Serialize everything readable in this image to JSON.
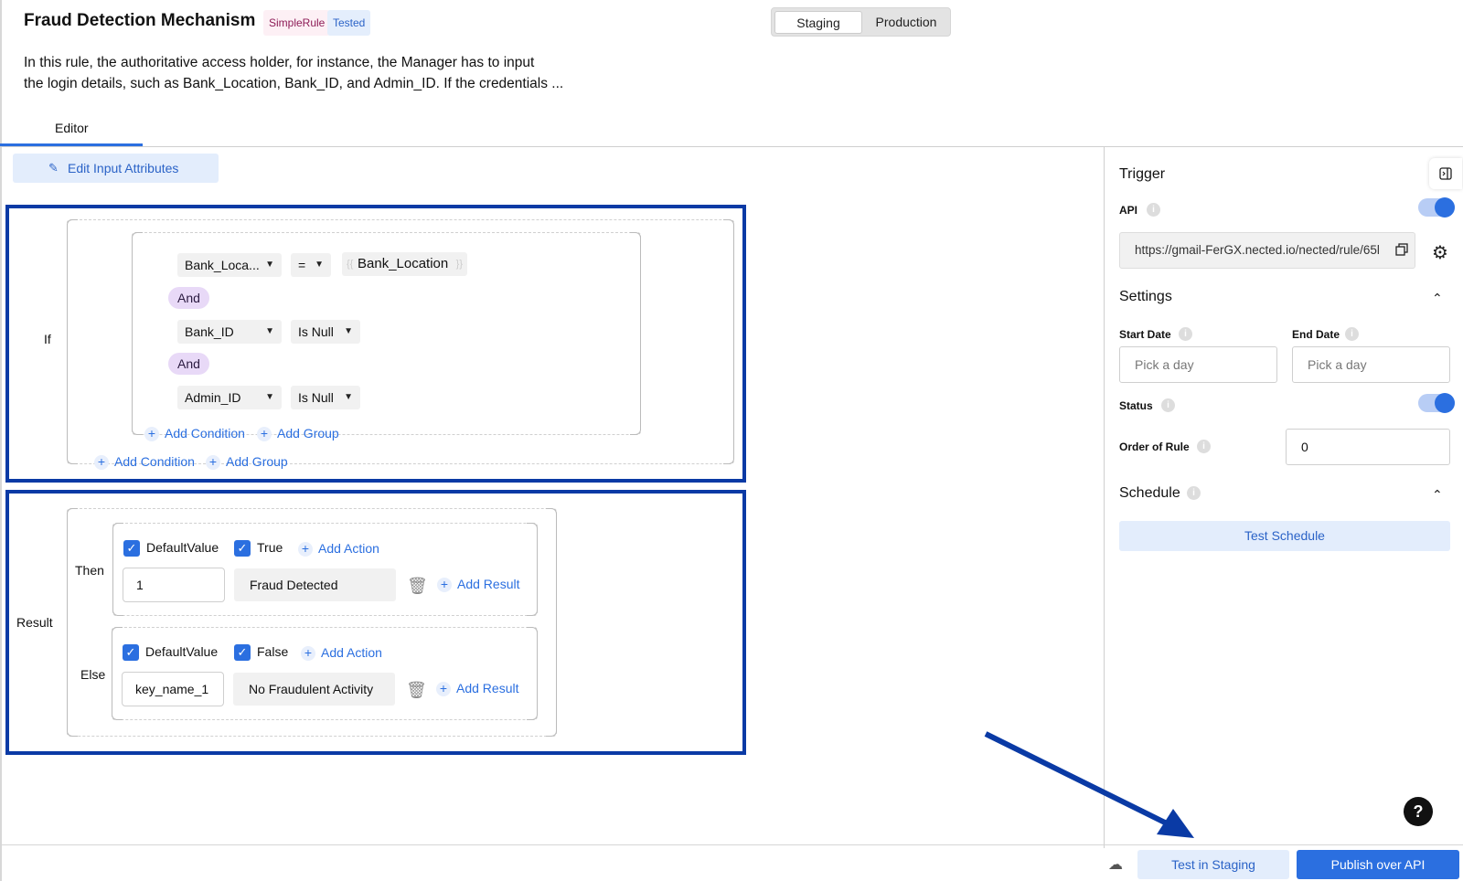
{
  "header": {
    "title": "Fraud Detection Mechanism",
    "badges": [
      "SimpleRule",
      "Tested"
    ],
    "environments": [
      "Staging",
      "Production"
    ],
    "selected_environment": "Staging",
    "description_lines": [
      "In this rule, the authoritative access holder, for instance, the Manager has to input",
      "the login details, such as Bank_Location, Bank_ID, and Admin_ID. If the credentials ..."
    ],
    "tabs": [
      "Editor"
    ]
  },
  "editor": {
    "edit_input_label": "Edit Input Attributes",
    "if_label": "If",
    "conditions": [
      {
        "field": "Bank_Loca...",
        "operator": "=",
        "value": "Bank_Location"
      },
      {
        "field": "Bank_ID",
        "operator": "Is Null"
      },
      {
        "field": "Admin_ID",
        "operator": "Is Null"
      }
    ],
    "connectors": [
      "And",
      "And"
    ],
    "add_condition": "Add Condition",
    "add_group": "Add Group",
    "result_label": "Result",
    "then": {
      "label": "Then",
      "checks": [
        "DefaultValue",
        "True"
      ],
      "add_action": "Add Action",
      "key": "1",
      "value": "Fraud Detected",
      "add_result": "Add Result"
    },
    "else": {
      "label": "Else",
      "checks": [
        "DefaultValue",
        "False"
      ],
      "add_action": "Add Action",
      "key": "key_name_1",
      "value": "No Fraudulent Activity",
      "add_result": "Add Result"
    }
  },
  "panel": {
    "trigger_title": "Trigger",
    "api_label": "API",
    "api_enabled": true,
    "api_url": "https://gmail-FerGX.nected.io/nected/rule/65l",
    "settings_title": "Settings",
    "start_date_label": "Start Date",
    "end_date_label": "End Date",
    "date_placeholder": "Pick a day",
    "status_label": "Status",
    "status_enabled": true,
    "order_label": "Order of Rule",
    "order_value": "0",
    "schedule_title": "Schedule",
    "test_schedule": "Test Schedule"
  },
  "footer": {
    "test_staging": "Test in Staging",
    "publish": "Publish over API",
    "help": "?"
  },
  "colors": {
    "accent": "#2b6fe0",
    "highlight_box": "#0a3aa5",
    "pill": "#e8d9f7"
  }
}
